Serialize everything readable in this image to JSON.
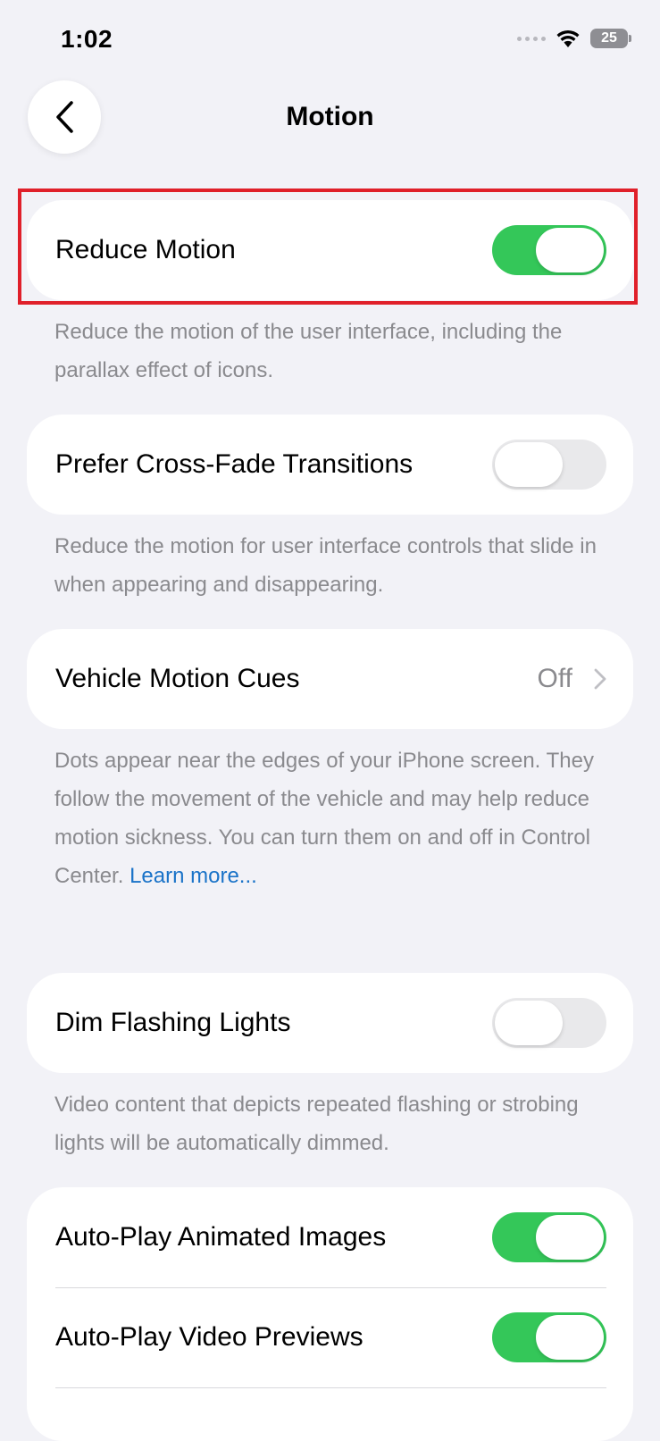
{
  "status": {
    "time": "1:02",
    "battery": "25"
  },
  "nav": {
    "title": "Motion"
  },
  "colors": {
    "toggle_on": "#34c759",
    "toggle_off": "#e9e9eb",
    "link": "#1a73c8",
    "highlight": "#e0202a",
    "background": "#f2f2f7"
  },
  "settings": {
    "reduce_motion": {
      "label": "Reduce Motion",
      "on": true,
      "footer": "Reduce the motion of the user interface, including the parallax effect of icons."
    },
    "cross_fade": {
      "label": "Prefer Cross-Fade Transitions",
      "on": false,
      "footer": "Reduce the motion for user interface controls that slide in when appearing and disappearing."
    },
    "vehicle_cues": {
      "label": "Vehicle Motion Cues",
      "value": "Off",
      "footer": "Dots appear near the edges of your iPhone screen. They follow the movement of the vehicle and may help reduce motion sickness. You can turn them on and off in Control Center.",
      "link": "Learn more..."
    },
    "dim_flashing": {
      "label": "Dim Flashing Lights",
      "on": false,
      "footer": "Video content that depicts repeated flashing or strobing lights will be automatically dimmed."
    },
    "autoplay_images": {
      "label": "Auto-Play Animated Images",
      "on": true
    },
    "autoplay_video": {
      "label": "Auto-Play Video Previews",
      "on": true
    }
  }
}
